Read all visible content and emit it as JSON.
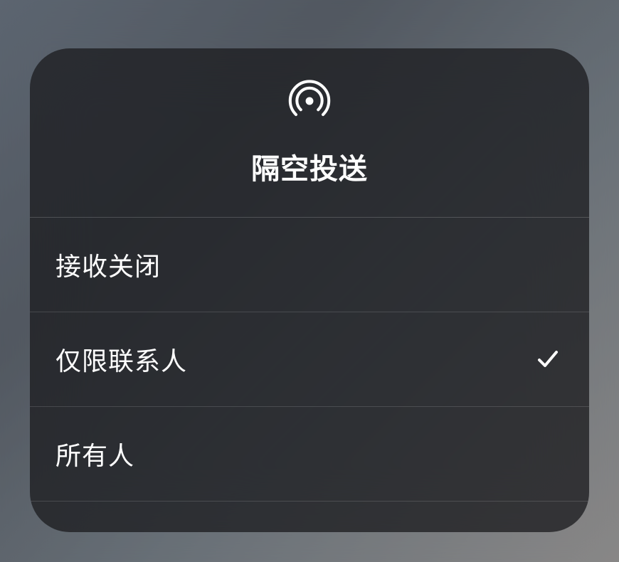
{
  "header": {
    "title": "隔空投送"
  },
  "options": [
    {
      "label": "接收关闭",
      "selected": false
    },
    {
      "label": "仅限联系人",
      "selected": true
    },
    {
      "label": "所有人",
      "selected": false
    }
  ]
}
